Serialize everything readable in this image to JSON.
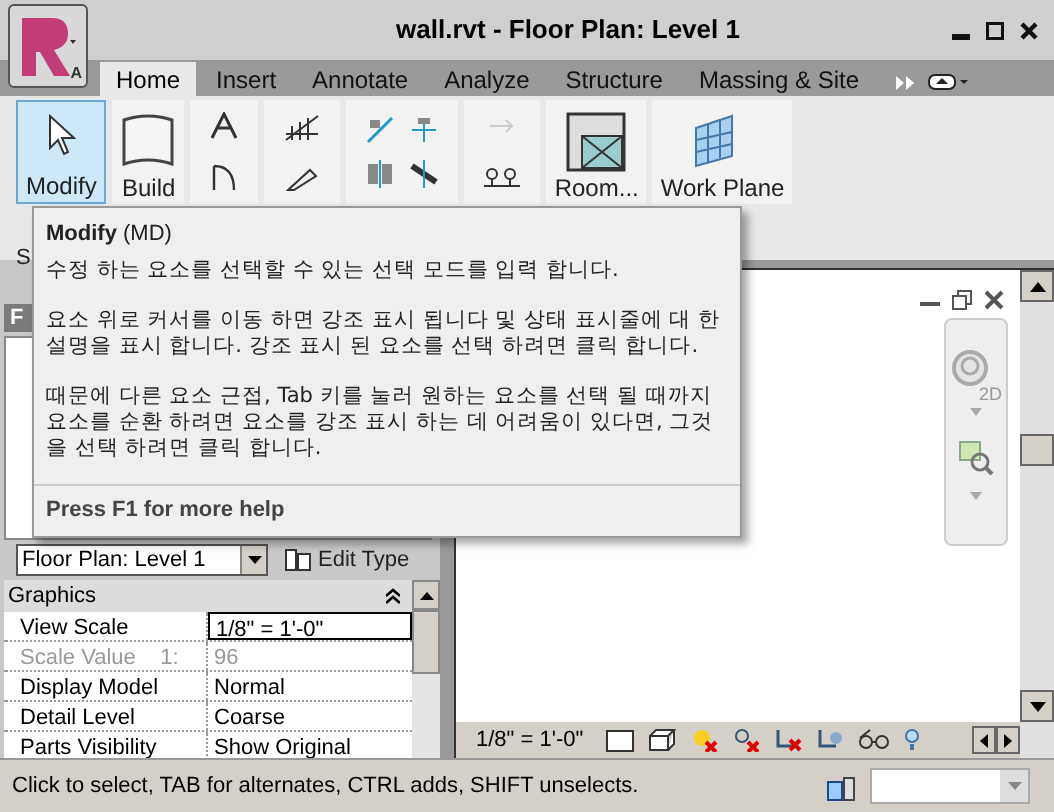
{
  "window": {
    "title": "wall.rvt - Floor Plan: Level 1",
    "app_badge": "A"
  },
  "tabs": [
    {
      "label": "Home",
      "selected": true
    },
    {
      "label": "Insert",
      "selected": false
    },
    {
      "label": "Annotate",
      "selected": false
    },
    {
      "label": "Analyze",
      "selected": false
    },
    {
      "label": "Structure",
      "selected": false
    },
    {
      "label": "Massing & Site",
      "selected": false
    }
  ],
  "ribbon": [
    {
      "kind": "large",
      "label": "Modify",
      "selected": true
    },
    {
      "kind": "large",
      "label": "Build",
      "selected": false
    },
    {
      "kind": "icons"
    },
    {
      "kind": "icons"
    },
    {
      "kind": "icons"
    },
    {
      "kind": "icons"
    },
    {
      "kind": "large",
      "label": "Room...",
      "selected": false
    },
    {
      "kind": "large",
      "label": "Work Plane",
      "selected": false
    }
  ],
  "ribbon_panel_label": "S",
  "tooltip": {
    "title": "Modify",
    "shortcut": "(MD)",
    "paragraphs": [
      "수정 하는 요소를 선택할 수 있는 선택 모드를 입력 합니다.",
      "요소 위로 커서를 이동 하면 강조 표시 됩니다 및 상태 표시줄에 대 한 설명을 표시 합니다. 강조 표시 된 요소를 선택 하려면 클릭 합니다.",
      "때문에 다른 요소 근접, Tab 키를 눌러 원하는 요소를 선택 될 때까지 요소를 순환 하려면 요소를 강조 표시 하는 데 어려움이 있다면, 그것을 선택 하려면 클릭 합니다."
    ],
    "footer": "Press F1 for more help"
  },
  "properties": {
    "title": "F",
    "type_selector": "Floor Plan: Level 1",
    "edit_type": "Edit Type",
    "group": "Graphics",
    "rows": [
      {
        "name": "View Scale",
        "value": "1/8\" = 1'-0\"",
        "disabled": false,
        "editing": true
      },
      {
        "name": "Scale Value    1:",
        "value": "96",
        "disabled": true,
        "editing": false
      },
      {
        "name": "Display Model",
        "value": "Normal",
        "disabled": false,
        "editing": false
      },
      {
        "name": "Detail Level",
        "value": "Coarse",
        "disabled": false,
        "editing": false
      },
      {
        "name": "Parts Visibility",
        "value": "Show Original",
        "disabled": false,
        "editing": false
      }
    ]
  },
  "view": {
    "nav_label": "2D",
    "scale": "1/8\" = 1'-0\""
  },
  "status_bar": {
    "message": "Click to select, TAB for alternates, CTRL adds, SHIFT unselects."
  }
}
